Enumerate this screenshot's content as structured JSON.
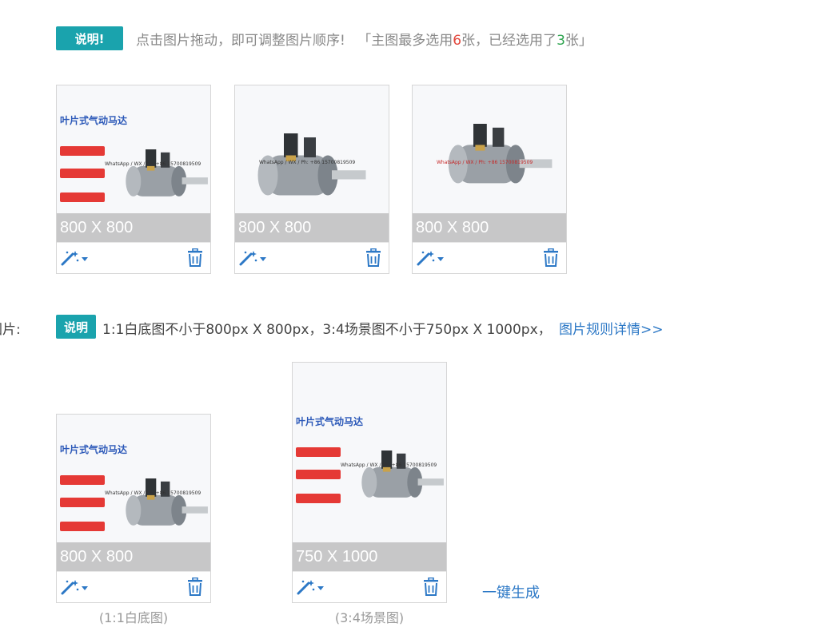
{
  "top_note": {
    "badge": "说明!",
    "text_a": "点击图片拖动，即可调整图片顺序!",
    "text_b": "「主图最多选用",
    "max": "6",
    "text_c": "张，已经选用了",
    "used": "3",
    "text_d": "张」"
  },
  "main_images": [
    {
      "size": "800 X 800",
      "variant": "catalog"
    },
    {
      "size": "800 X 800",
      "variant": "front"
    },
    {
      "size": "800 X 800",
      "variant": "angle"
    }
  ],
  "section_label": "图片:",
  "spec_note": {
    "badge": "说明",
    "text": "1:1白底图不小于800px X 800px，3:4场景图不小于750px X 1000px，",
    "link": "图片规则详情>>"
  },
  "bottom_images": [
    {
      "size": "800 X 800",
      "caption": "(1:1白底图)"
    },
    {
      "size": "750 X 1000",
      "caption": "(3:4场景图)"
    }
  ],
  "generate_link": "一键生成",
  "product_text": {
    "title": "叶片式气动马达",
    "watermark": "WhatsApp / WX / Ph: +86 15700819509"
  },
  "colors": {
    "accent": "#1aa3ad",
    "link": "#2c78c6",
    "red": "#e2463b",
    "green": "#2ea44f"
  },
  "icons": {
    "edit": "magic-wand-icon",
    "delete": "trash-icon"
  }
}
